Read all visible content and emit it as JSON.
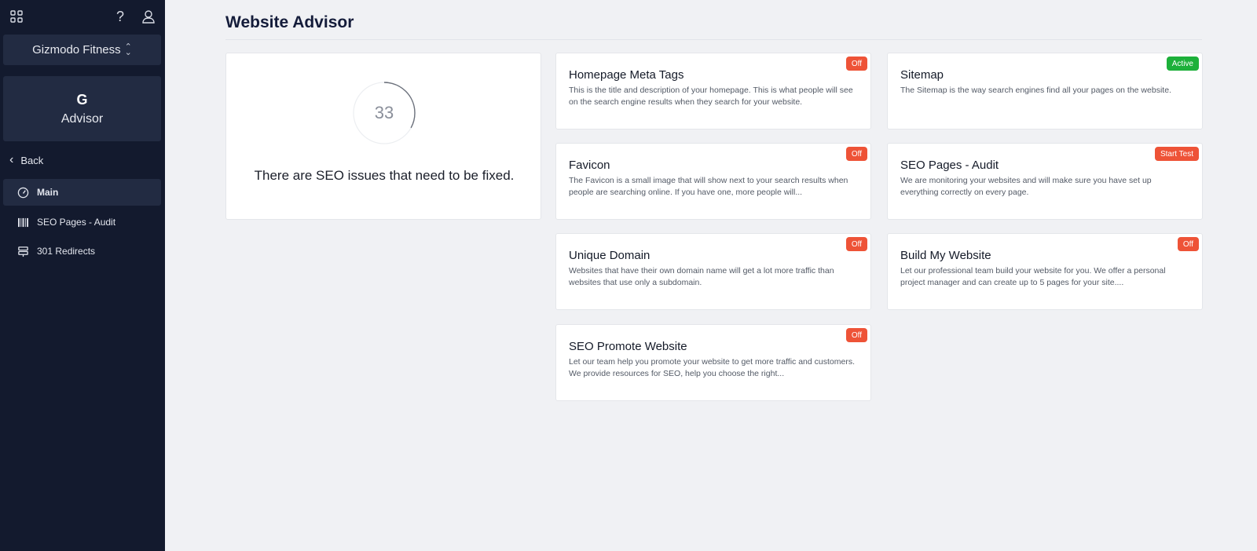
{
  "sidebar": {
    "site_name": "Gizmodo Fitness",
    "app": {
      "logo_letter": "G",
      "name": "Advisor"
    },
    "back_label": "Back",
    "nav": [
      {
        "label": "Main",
        "icon": "gauge-icon",
        "active": true
      },
      {
        "label": "SEO Pages - Audit",
        "icon": "barcode-icon",
        "active": false
      },
      {
        "label": "301 Redirects",
        "icon": "signpost-icon",
        "active": false
      }
    ]
  },
  "main": {
    "title": "Website Advisor",
    "score": {
      "value": "33",
      "progress_percent": 33,
      "message": "There are SEO issues that need to be fixed."
    },
    "cards": [
      {
        "title": "Homepage Meta Tags",
        "description": "This is the title and description of your homepage. This is what people will see on the search engine results when they search for your website.",
        "badge": "Off"
      },
      {
        "title": "Sitemap",
        "description": "The Sitemap is the way search engines find all your pages on the website.",
        "badge": "Active"
      },
      {
        "title": "Favicon",
        "description": "The Favicon is a small image that will show next to your search results when people are searching online. If you have one, more people will...",
        "badge": "Off"
      },
      {
        "title": "SEO Pages - Audit",
        "description": "We are monitoring your websites and will make sure you have set up everything correctly on every page.",
        "badge": "Start Test"
      },
      {
        "title": "Unique Domain",
        "description": "Websites that have their own domain name will get a lot more traffic than websites that use only a subdomain.",
        "badge": "Off"
      },
      {
        "title": "Build My Website",
        "description": "Let our professional team build your website for you. We offer a personal project manager and can create up to 5 pages for your site....",
        "badge": "Off"
      },
      {
        "title": "SEO Promote Website",
        "description": "Let our team help you promote your website to get more traffic and customers. We provide resources for SEO, help you choose the right...",
        "badge": "Off"
      }
    ]
  },
  "colors": {
    "sidebar_bg": "#131a2e",
    "sidebar_panel": "#222b42",
    "badge_off": "#ee5337",
    "badge_active": "#1db03a",
    "title": "#141c3a"
  }
}
